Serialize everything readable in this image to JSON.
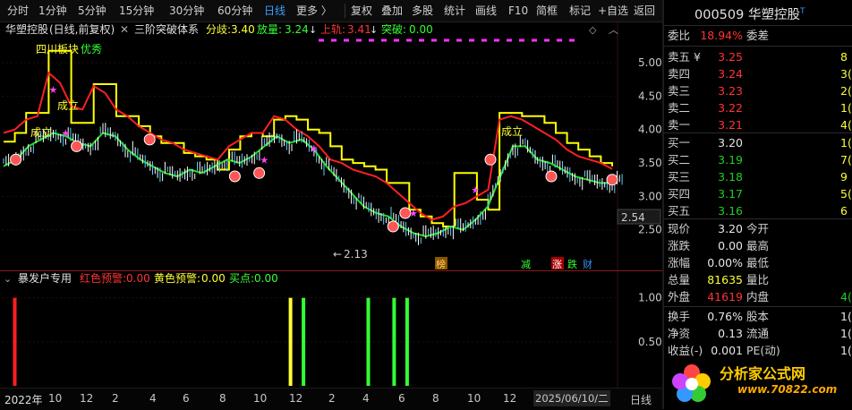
{
  "toolbar": {
    "periods": [
      "分时",
      "1分钟",
      "5分钟",
      "15分钟",
      "30分钟",
      "60分钟",
      "日线",
      "更多 〉"
    ],
    "active_period": "日线",
    "actions": [
      "复权",
      "叠加",
      "多股",
      "统计",
      "画线",
      "F10",
      "简框",
      "标记",
      "+自选",
      "返回"
    ]
  },
  "main_header": {
    "stock_label": "华塑控股",
    "mode": "(日线,前复权)",
    "indicator_name": "三阶突破体系",
    "divergence_label": "分歧:",
    "divergence_value": "3.40",
    "volume_label": "放量:",
    "volume_value": "3.24",
    "upper_label": "上轨:",
    "upper_value": "3.41",
    "breakout_label": "突破:",
    "breakout_value": "0.00"
  },
  "chart_annotations": {
    "sector_text": "四川板块",
    "quality_text": "优秀",
    "established_1": "成立",
    "established_2": "成立",
    "established_3": "成立",
    "low_marker": "2.13",
    "last_price_tag": "2.54",
    "tag_list": "榜",
    "tag_reduce": "减",
    "tag_rise": "涨",
    "tag_fall": "跌",
    "tag_finance": "财"
  },
  "sub_header": {
    "name": "暴发户专用",
    "red_label": "红色预警:",
    "red_value": "0.00",
    "yellow_label": "黄色预警:",
    "yellow_value": "0.00",
    "buy_label": "买点:",
    "buy_value": "0.00"
  },
  "x_axis": {
    "labels": [
      "2022年",
      "10",
      "12",
      "2",
      "4",
      "6",
      "8",
      "10",
      "12",
      "2",
      "4",
      "6",
      "8",
      "10",
      "12"
    ],
    "cursor_date": "2025/06/10/二",
    "period_label": "日线"
  },
  "chart_data": [
    {
      "type": "line",
      "title": "三阶突破体系",
      "y_ticks": [
        5.0,
        4.5,
        4.0,
        3.5,
        3.0,
        2.5
      ],
      "ylim": [
        2.0,
        5.35
      ],
      "series": [
        {
          "name": "分歧",
          "color": "#ffff00",
          "values": [
            3.82,
            3.95,
            4.25,
            4.25,
            5.18,
            5.18,
            4.1,
            4.1,
            4.68,
            4.68,
            4.2,
            4.2,
            4.05,
            3.9,
            3.8,
            3.8,
            3.65,
            3.6,
            3.55,
            3.4,
            3.7,
            3.9,
            3.95,
            3.9,
            4.15,
            4.2,
            4.15,
            4.0,
            3.95,
            3.75,
            3.55,
            3.5,
            3.45,
            3.4,
            3.2,
            3.2,
            2.8,
            2.7,
            2.6,
            2.55,
            3.35,
            3.35,
            2.95,
            2.8,
            4.25,
            4.25,
            4.2,
            4.2,
            4.1,
            3.95,
            3.8,
            3.7,
            3.6,
            3.5,
            3.45
          ]
        },
        {
          "name": "上轨",
          "color": "#ff2020",
          "values": [
            3.95,
            4.0,
            4.15,
            4.2,
            4.85,
            4.7,
            4.35,
            4.3,
            4.65,
            4.55,
            4.3,
            4.2,
            4.05,
            3.95,
            3.85,
            3.8,
            3.7,
            3.65,
            3.6,
            3.55,
            3.75,
            3.85,
            3.95,
            3.95,
            4.2,
            4.15,
            4.0,
            3.9,
            3.75,
            3.55,
            3.5,
            3.4,
            3.35,
            3.3,
            3.2,
            3.05,
            2.9,
            2.75,
            2.65,
            2.7,
            2.85,
            2.9,
            3.0,
            3.1,
            4.15,
            4.2,
            4.15,
            4.05,
            3.95,
            3.85,
            3.7,
            3.6,
            3.55,
            3.5,
            3.41
          ]
        },
        {
          "name": "中线",
          "color": "#22dd22",
          "values": [
            3.45,
            3.55,
            3.75,
            3.85,
            3.95,
            3.9,
            3.8,
            3.75,
            3.95,
            3.9,
            3.7,
            3.55,
            3.45,
            3.35,
            3.3,
            3.4,
            3.35,
            3.45,
            3.55,
            3.5,
            3.6,
            3.75,
            3.9,
            3.8,
            3.85,
            3.7,
            3.45,
            3.25,
            3.05,
            2.85,
            2.75,
            2.7,
            2.55,
            2.45,
            2.4,
            2.45,
            2.55,
            2.5,
            2.65,
            2.85,
            3.3,
            3.75,
            3.75,
            3.55,
            3.5,
            3.4,
            3.3,
            3.25,
            3.2,
            3.2
          ]
        }
      ]
    },
    {
      "type": "bar",
      "title": "暴发户专用",
      "y_ticks": [
        1.0,
        0.5
      ],
      "ylim": [
        0,
        1.2
      ],
      "series": [
        {
          "name": "红色预警",
          "color": "#ff2020",
          "bars": [
            {
              "x_index": 1,
              "value": 1.0
            }
          ]
        },
        {
          "name": "黄色预警",
          "color": "#ffff33",
          "bars": [
            {
              "x_index": 22,
              "value": 1.0
            }
          ]
        },
        {
          "name": "买点",
          "color": "#33ff33",
          "bars": [
            {
              "x_index": 23,
              "value": 1.0
            },
            {
              "x_index": 28,
              "value": 1.0
            },
            {
              "x_index": 30,
              "value": 1.0
            },
            {
              "x_index": 31,
              "value": 1.0
            }
          ]
        }
      ]
    }
  ],
  "quote": {
    "code": "000509",
    "name": "华塑控股",
    "mark": "T",
    "ratio_label": "委比",
    "ratio_value": "18.94%",
    "diff_label": "委差",
    "asks": [
      {
        "label": "卖五 ¥",
        "price": "3.25",
        "vol": "8"
      },
      {
        "label": "卖四",
        "price": "3.24",
        "vol": "3("
      },
      {
        "label": "卖三",
        "price": "3.23",
        "vol": "2("
      },
      {
        "label": "卖二",
        "price": "3.22",
        "vol": "1("
      },
      {
        "label": "卖一",
        "price": "3.21",
        "vol": "4("
      }
    ],
    "bids": [
      {
        "label": "买一",
        "price": "3.20",
        "vol": "1("
      },
      {
        "label": "买二",
        "price": "3.19",
        "vol": "7("
      },
      {
        "label": "买三",
        "price": "3.18",
        "vol": "9"
      },
      {
        "label": "买四",
        "price": "3.17",
        "vol": "5("
      },
      {
        "label": "买五",
        "price": "3.16",
        "vol": "6"
      }
    ],
    "stats": [
      {
        "l1": "现价",
        "v1": "3.20",
        "l2": "今开",
        "v2": ""
      },
      {
        "l1": "涨跌",
        "v1": "0.00",
        "l2": "最高",
        "v2": ""
      },
      {
        "l1": "涨幅",
        "v1": "0.00%",
        "l2": "最低",
        "v2": ""
      },
      {
        "l1": "总量",
        "v1": "81635",
        "l2": "量比",
        "v2": ""
      },
      {
        "l1": "外盘",
        "v1": "41619",
        "l2": "内盘",
        "v2": "4("
      }
    ],
    "stats2": [
      {
        "l1": "换手",
        "v1": "0.76%",
        "l2": "股本",
        "v2": "1("
      },
      {
        "l1": "净资",
        "v1": "0.13",
        "l2": "流通",
        "v2": "1("
      },
      {
        "l1": "收益(-)",
        "v1": "0.001",
        "l2": "PE(动)",
        "v2": "1("
      }
    ],
    "logo_text": "分析家公式网",
    "logo_url": "www.70822.com"
  }
}
